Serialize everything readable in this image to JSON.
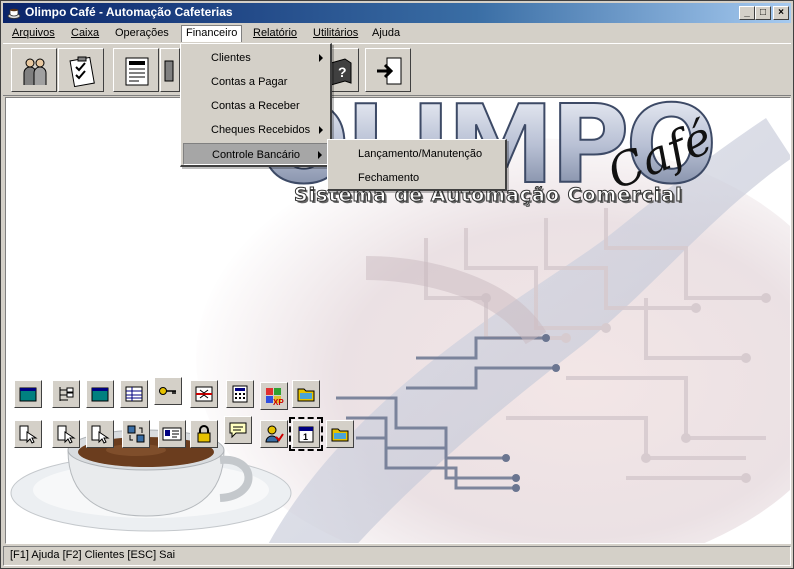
{
  "window": {
    "title": "Olimpo Café - Automação Cafeterias"
  },
  "title_buttons": [
    "minimize-icon",
    "maximize-icon",
    "close-icon"
  ],
  "menubar": {
    "items": [
      {
        "label": "Arquivos",
        "underline": "A"
      },
      {
        "label": "Caixa",
        "underline": "C"
      },
      {
        "label": "Operações",
        "underline": "O"
      },
      {
        "label": "Financeiro",
        "underline": "F",
        "active": true
      },
      {
        "label": "Relatório",
        "underline": "R"
      },
      {
        "label": "Utilitários",
        "underline": "U"
      },
      {
        "label": "Ajuda",
        "underline": "A"
      }
    ]
  },
  "financeiro_menu": {
    "items": [
      {
        "label": "Clientes",
        "submenu": true
      },
      {
        "label": "Contas a Pagar",
        "submenu": false
      },
      {
        "label": "Contas a Receber",
        "submenu": false
      },
      {
        "label": "Cheques Recebidos",
        "submenu": true
      },
      {
        "label": "Controle Bancário",
        "submenu": true,
        "highlighted": true
      }
    ]
  },
  "controle_bancario_menu": {
    "items": [
      {
        "label": "Lançamento/Manutenção"
      },
      {
        "label": "Fechamento"
      }
    ]
  },
  "toolbar": {
    "icons": [
      "people-icon",
      "checklist-icon",
      "document-icon",
      "tools-icon",
      "help-book-icon",
      "exit-door-icon"
    ]
  },
  "logo": {
    "main": "OLIMPO",
    "script": "Café",
    "subtitle": "Sistema de Automação Comercial"
  },
  "quick_buttons_row1": [
    "window-icon",
    "tree-icon",
    "window-icon",
    "grid-icon",
    "key-icon",
    "split-icon",
    "calculator-icon",
    "xp-icon",
    "folder-icon"
  ],
  "quick_buttons_row2": [
    "cursor-icon",
    "cursor-icon",
    "cursor-icon",
    "transfer-icon",
    "id-card-icon",
    "lock-icon",
    "message-icon",
    "user-check-icon",
    "calendar-icon",
    "folder-icon"
  ],
  "statusbar": {
    "text": "[F1] Ajuda [F2] Clientes [ESC] Sai"
  },
  "colors": {
    "title_start": "#0a246a",
    "title_end": "#a6caf0",
    "face": "#d4d0c8"
  }
}
